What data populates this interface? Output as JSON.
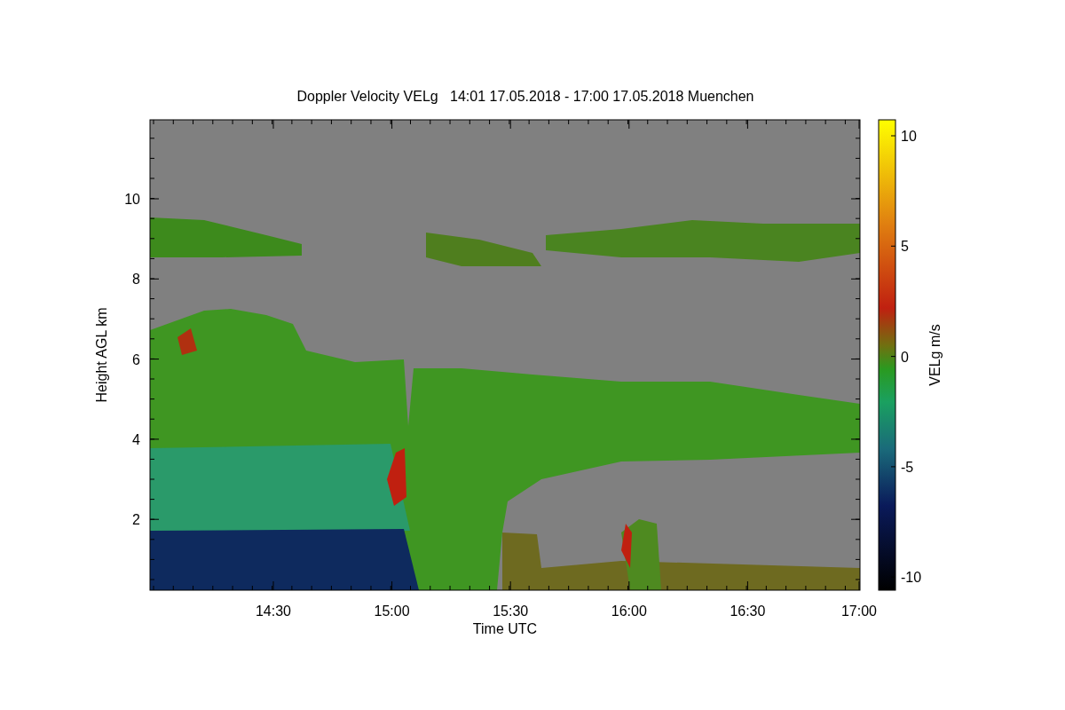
{
  "plot": {
    "title": "Doppler Velocity VELg   14:01 17.05.2018 - 17:00 17.05.2018 Muenchen",
    "xlabel": "Time UTC",
    "ylabel": "Height AGL km",
    "xticks": [
      "14:30",
      "15:00",
      "15:30",
      "16:00",
      "16:30",
      "17:00"
    ],
    "yticks": [
      "10",
      "8",
      "6",
      "4",
      "2"
    ]
  },
  "colorbar": {
    "label": "VELg m/s",
    "ticks": [
      "10",
      "5",
      "0",
      "-5",
      "-10"
    ]
  }
}
